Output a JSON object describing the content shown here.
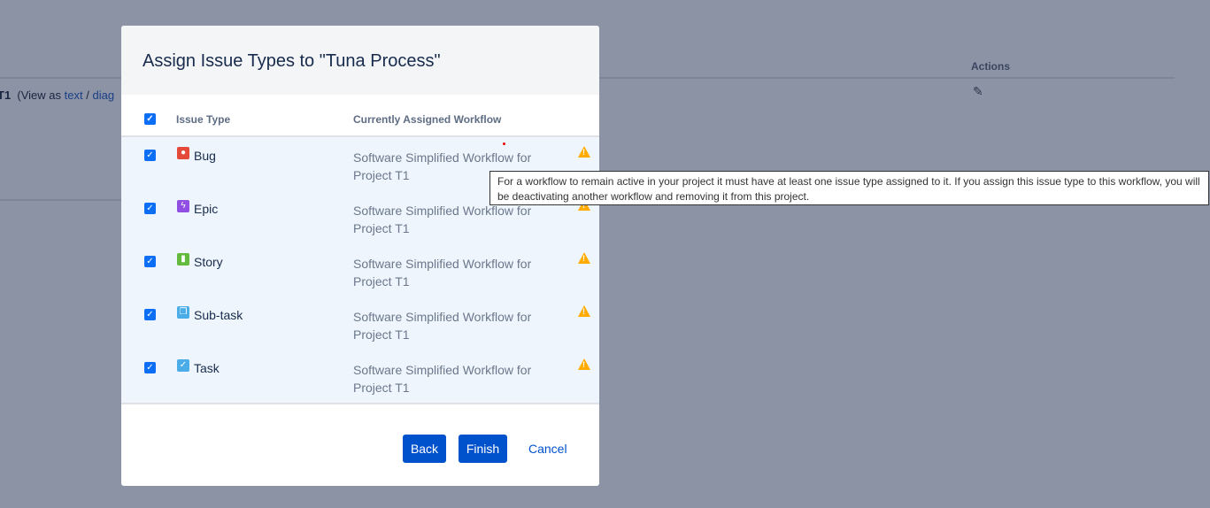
{
  "background": {
    "actions_header": "Actions",
    "row_prefix": "T1",
    "view_as": "(View as",
    "text_link": "text",
    "separator": "/",
    "diagram_link": "diag"
  },
  "dialog": {
    "title": "Assign Issue Types to \"Tuna Process\"",
    "columns": {
      "issue_type": "Issue Type",
      "workflow": "Currently Assigned Workflow"
    },
    "rows": [
      {
        "type": "Bug",
        "color": "#e5493a",
        "glyph": "●",
        "workflow": "Software Simplified Workflow for Project T1",
        "checked": true
      },
      {
        "type": "Epic",
        "color": "#904ee2",
        "glyph": "ϟ",
        "workflow": "Software Simplified Workflow for Project T1",
        "checked": true
      },
      {
        "type": "Story",
        "color": "#63ba3c",
        "glyph": "▮",
        "workflow": "Software Simplified Workflow for Project T1",
        "checked": true
      },
      {
        "type": "Sub-task",
        "color": "#4bade8",
        "glyph": "❐",
        "workflow": "Software Simplified Workflow for Project T1",
        "checked": true
      },
      {
        "type": "Task",
        "color": "#4bade8",
        "glyph": "✓",
        "workflow": "Software Simplified Workflow for Project T1",
        "checked": true
      }
    ],
    "buttons": {
      "back": "Back",
      "finish": "Finish",
      "cancel": "Cancel"
    }
  },
  "tooltip": "For a workflow to remain active in your project it must have at least one issue type assigned to it. If you assign this issue type to this workflow, you will be deactivating another workflow and removing it from this project."
}
